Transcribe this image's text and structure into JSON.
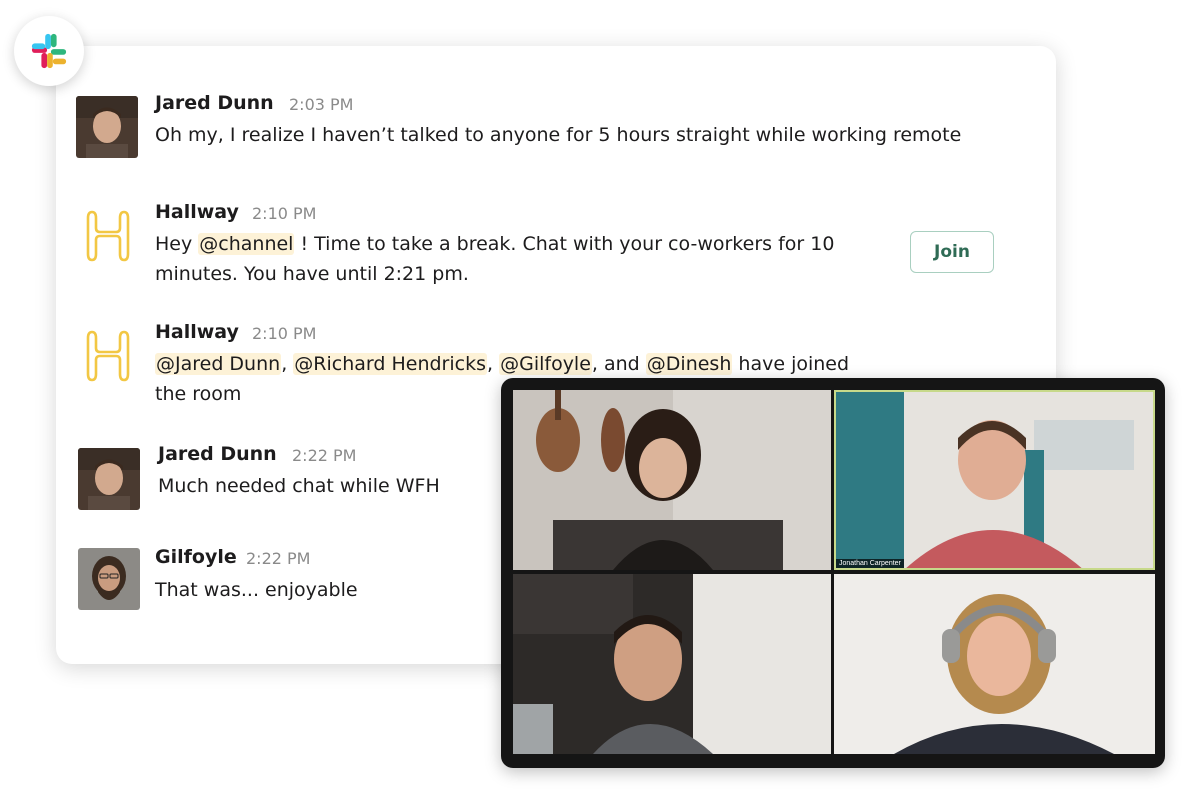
{
  "app": {
    "logo_icon": "slack-logo-icon"
  },
  "messages": [
    {
      "author": "Jared Dunn",
      "time": "2:03 PM",
      "avatar": "jared-avatar",
      "text": "Oh my, I realize I haven’t talked to anyone for 5 hours straight while working remote"
    },
    {
      "author": "Hallway",
      "time": "2:10 PM",
      "avatar": "hallway-logo-icon",
      "text_before": "Hey ",
      "mention": "@channel",
      "text_after": " ! Time to take a break. Chat with your co-workers for 10 minutes.  You have until 2:21 pm.",
      "button_label": "Join"
    },
    {
      "author": "Hallway",
      "time": "2:10 PM",
      "avatar": "hallway-logo-icon",
      "mentions": [
        "@Jared Dunn",
        "@Richard Hendricks",
        "@Gilfoyle",
        "@Dinesh"
      ],
      "sep1": ", ",
      "sep2": ", ",
      "sep3": ", and ",
      "text_after": " have joined the room"
    },
    {
      "author": "Jared Dunn",
      "time": "2:22 PM",
      "avatar": "jared-avatar",
      "text": "Much needed chat while WFH"
    },
    {
      "author": "Gilfoyle",
      "time": "2:22 PM",
      "avatar": "gilfoyle-avatar",
      "text": "That was... enjoyable"
    }
  ],
  "video_call": {
    "participants": [
      {
        "tile": "top-left",
        "label": ""
      },
      {
        "tile": "top-right",
        "label": "Jonathan Carpenter",
        "active": true
      },
      {
        "tile": "bottom-left",
        "label": ""
      },
      {
        "tile": "bottom-right",
        "label": ""
      }
    ],
    "active_outline_color": "#c7d98a"
  },
  "colors": {
    "mention_bg": "#fdf2d7",
    "hallway_yellow": "#f2c744",
    "join_text": "#2f6b55"
  }
}
